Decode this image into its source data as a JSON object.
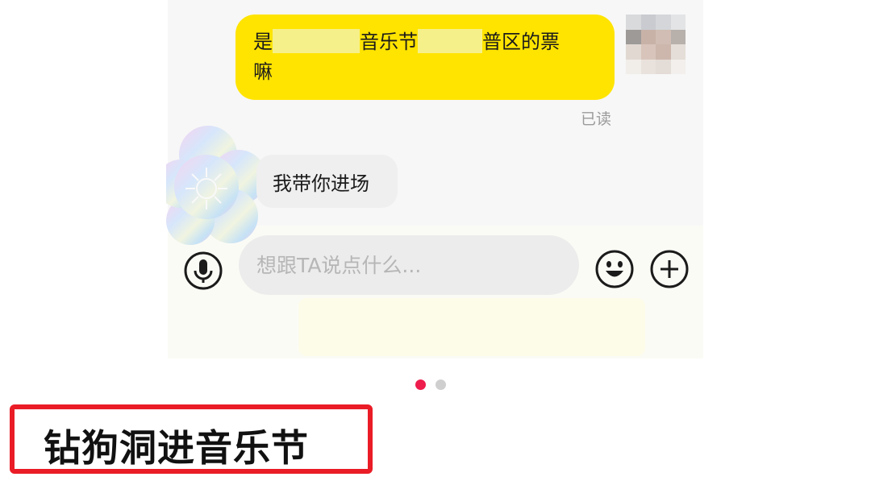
{
  "chat": {
    "sent_message": {
      "prefix": "是",
      "mid": "音乐节",
      "suffix": "普区的票",
      "line2": "嘛"
    },
    "read_status": "已读",
    "received_message": "我带你进场"
  },
  "composer": {
    "placeholder": "想跟TA说点什么..."
  },
  "pagination": {
    "total": 2,
    "current": 1
  },
  "caption": "钻狗洞进音乐节",
  "colors": {
    "sent_bubble": "#ffe400",
    "received_bubble": "#efefef",
    "dot_active": "#ee1d4c",
    "dot_inactive": "#cfcfcf",
    "caption_border": "#ea1c26"
  }
}
